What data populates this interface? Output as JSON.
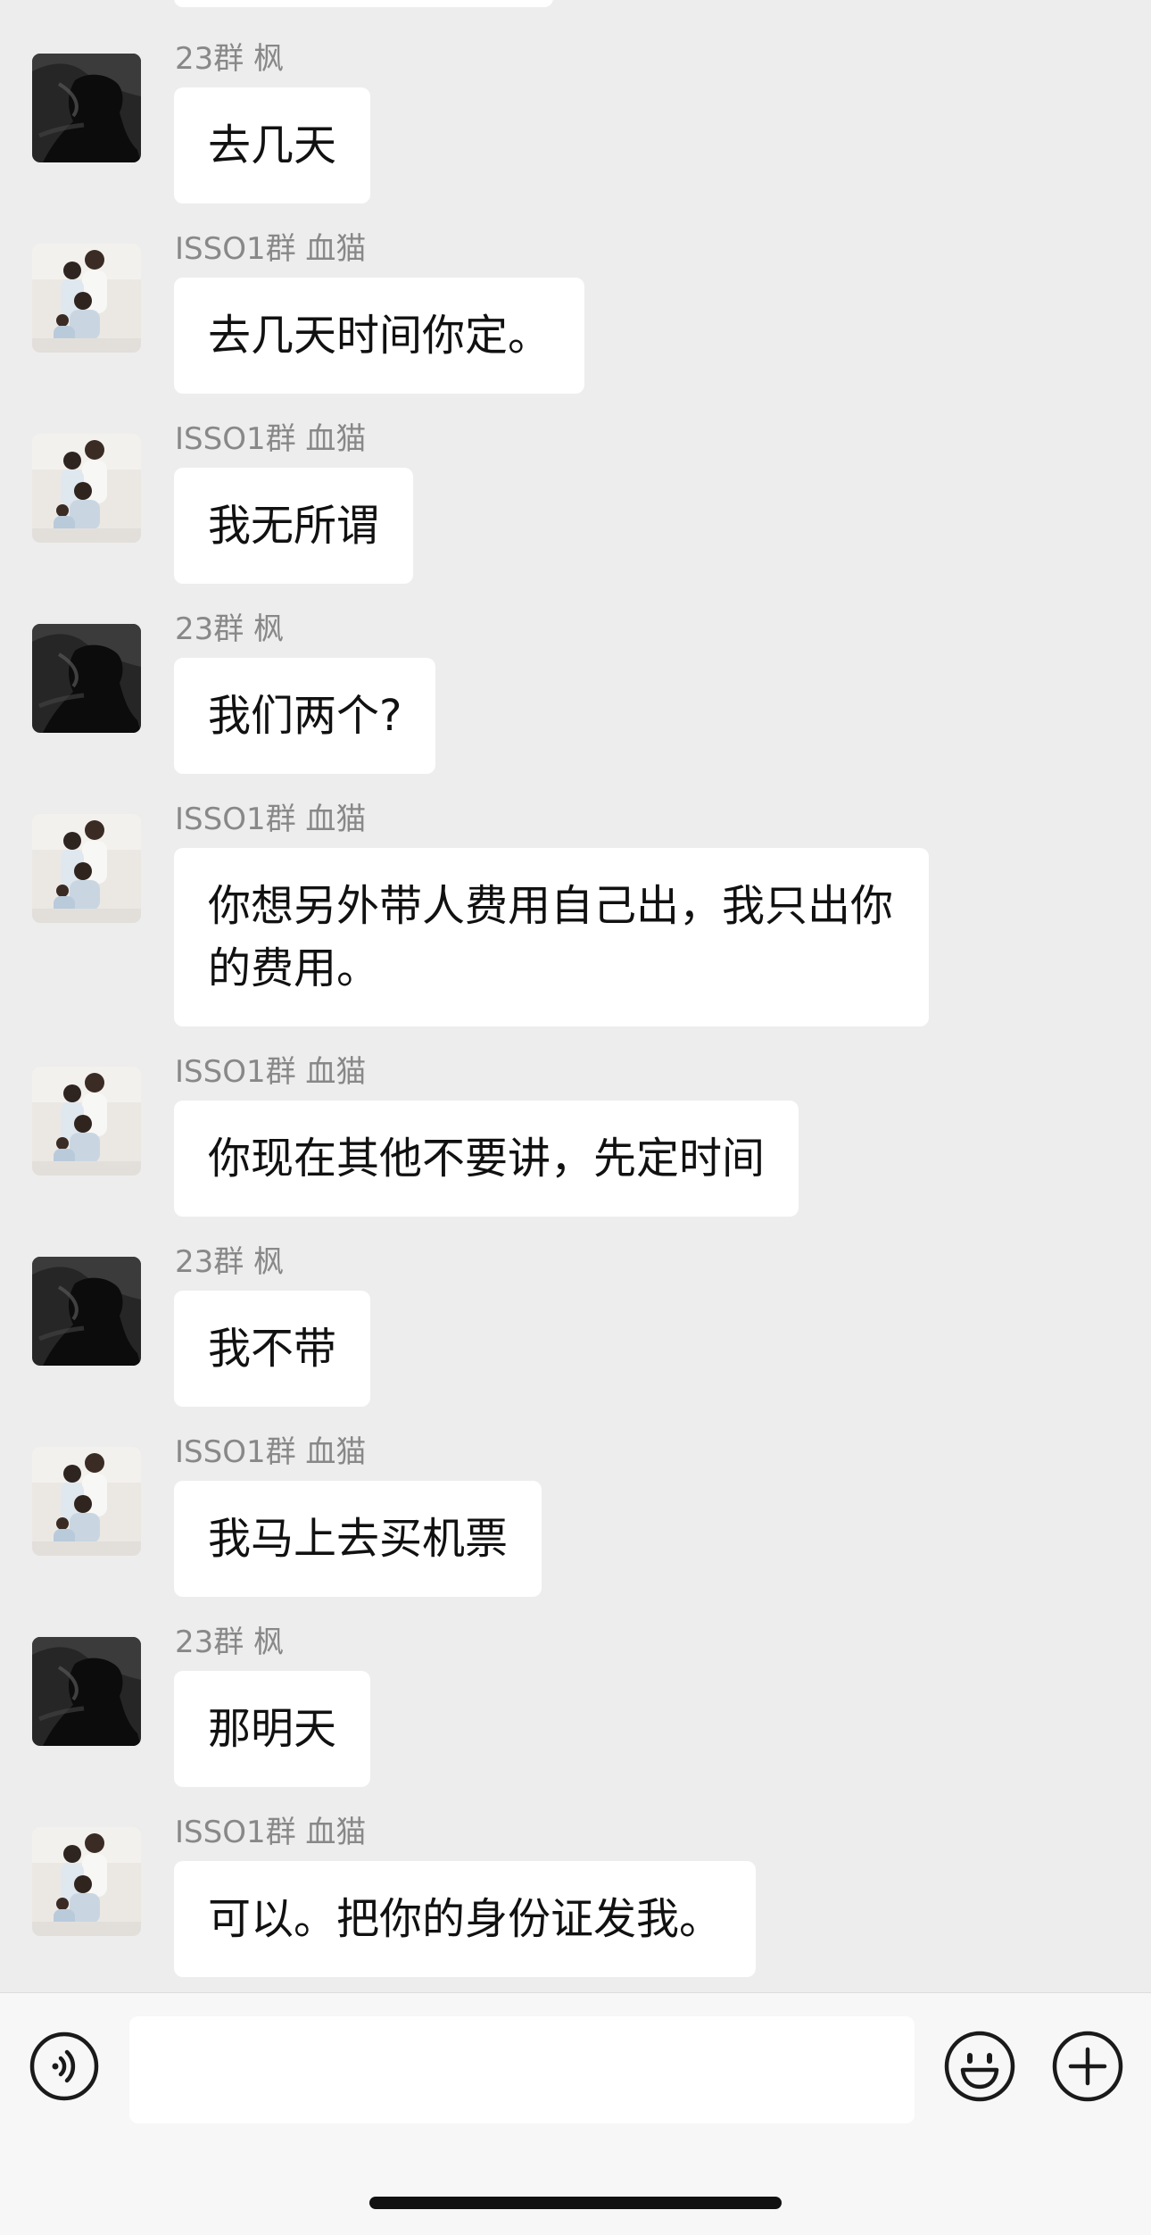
{
  "messages": [
    {
      "sender": "23群 枫",
      "avatar": "dark-silhouette-avatar",
      "text": "去几天"
    },
    {
      "sender": "ISSO1群 血猫",
      "avatar": "family-photo-avatar",
      "text": "去几天时间你定。"
    },
    {
      "sender": "ISSO1群 血猫",
      "avatar": "family-photo-avatar",
      "text": "我无所谓"
    },
    {
      "sender": "23群 枫",
      "avatar": "dark-silhouette-avatar",
      "text": "我们两个?"
    },
    {
      "sender": "ISSO1群 血猫",
      "avatar": "family-photo-avatar",
      "text": "你想另外带人费用自己出，我只出你的费用。"
    },
    {
      "sender": "ISSO1群 血猫",
      "avatar": "family-photo-avatar",
      "text": "你现在其他不要讲，先定时间"
    },
    {
      "sender": "23群 枫",
      "avatar": "dark-silhouette-avatar",
      "text": "我不带"
    },
    {
      "sender": "ISSO1群 血猫",
      "avatar": "family-photo-avatar",
      "text": "我马上去买机票"
    },
    {
      "sender": "23群 枫",
      "avatar": "dark-silhouette-avatar",
      "text": "那明天"
    },
    {
      "sender": "ISSO1群 血猫",
      "avatar": "family-photo-avatar",
      "text": "可以。把你的身份证发我。"
    }
  ],
  "input_bar": {
    "voice_icon": "voice-icon",
    "emoji_icon": "emoji-icon",
    "plus_icon": "plus-icon",
    "input_value": ""
  },
  "colors": {
    "chat_background": "#ededed",
    "bubble": "#ffffff",
    "sender_name": "#888888",
    "message_text": "#111111"
  }
}
